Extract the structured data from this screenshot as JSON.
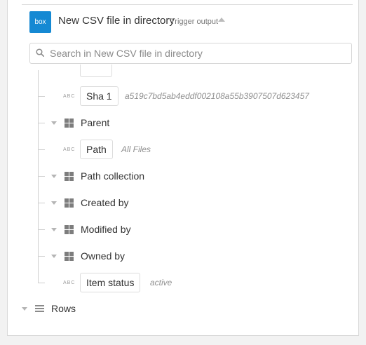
{
  "header": {
    "logo_text": "box",
    "title": "New CSV file in directory",
    "badge": "Trigger output"
  },
  "search": {
    "placeholder": "Search in New CSV file in directory"
  },
  "tree": {
    "sha1": {
      "type_tag": "ABC",
      "label": "Sha 1",
      "value": "a519c7bd5ab4eddf002108a55b3907507d623457"
    },
    "parent": {
      "label": "Parent"
    },
    "path": {
      "type_tag": "ABC",
      "label": "Path",
      "value": "All Files"
    },
    "path_collection": {
      "label": "Path collection"
    },
    "created_by": {
      "label": "Created by"
    },
    "modified_by": {
      "label": "Modified by"
    },
    "owned_by": {
      "label": "Owned by"
    },
    "item_status": {
      "type_tag": "ABC",
      "label": "Item status",
      "value": "active"
    },
    "rows": {
      "label": "Rows"
    }
  },
  "colors": {
    "brand": "#1589d3",
    "text": "#333333",
    "muted": "#8f8f8f",
    "border": "#dcdcdc"
  },
  "icons": {
    "logo": "box-logo-icon",
    "search": "search-icon",
    "object": "grid-icon",
    "list": "list-icon",
    "expand": "caret-down-icon",
    "collapse": "caret-up-icon"
  }
}
